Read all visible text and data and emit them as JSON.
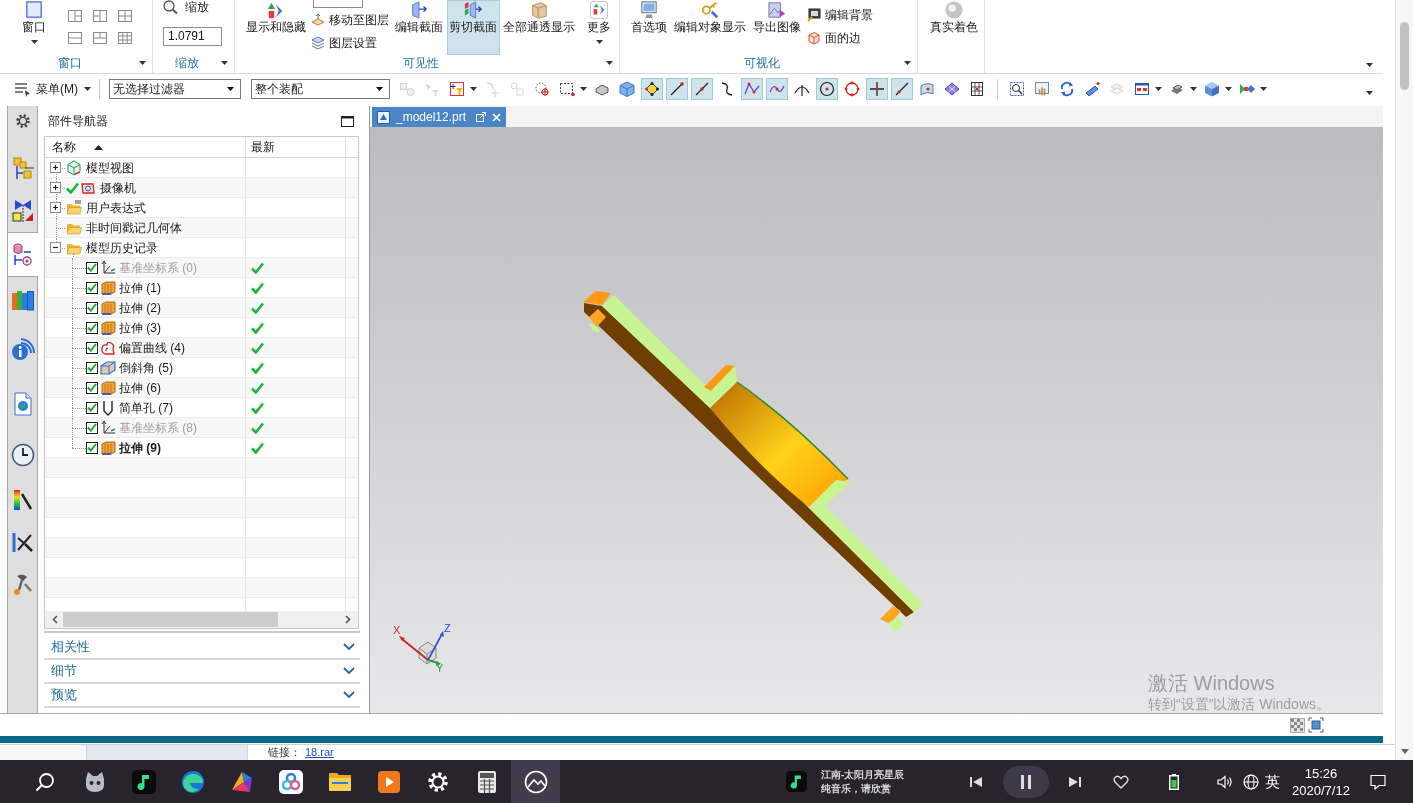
{
  "ribbon": {
    "groups": [
      {
        "label": "窗口",
        "items": [
          {
            "kind": "large",
            "label": "窗口",
            "dropdown": true,
            "selected": false
          },
          {
            "kind": "layouts"
          }
        ]
      },
      {
        "label": "缩放",
        "items": [
          {
            "kind": "zoom",
            "label": "缩放",
            "value": "1.0791"
          }
        ]
      },
      {
        "label": "可见性",
        "items": [
          {
            "kind": "large",
            "label": "显示和隐藏",
            "dropdown": false,
            "selected": false
          },
          {
            "kind": "stack",
            "entries": [
              {
                "kind": "field"
              },
              {
                "kind": "command",
                "label": "移动至图层"
              },
              {
                "kind": "command",
                "label": "图层设置"
              }
            ]
          },
          {
            "kind": "large",
            "label": "编辑截面",
            "dropdown": false,
            "selected": false
          },
          {
            "kind": "large",
            "label": "剪切截面",
            "dropdown": false,
            "selected": true
          },
          {
            "kind": "large",
            "label": "全部通透显示",
            "dropdown": false,
            "selected": false
          },
          {
            "kind": "large",
            "label": "更多",
            "dropdown": true,
            "selected": false
          }
        ]
      },
      {
        "label": "可视化",
        "items": [
          {
            "kind": "large",
            "label": "首选项",
            "dropdown": false,
            "selected": false
          },
          {
            "kind": "large",
            "label": "编辑对象显示",
            "dropdown": false,
            "selected": false
          },
          {
            "kind": "large",
            "label": "导出图像",
            "dropdown": false,
            "selected": false
          },
          {
            "kind": "stack",
            "entries": [
              {
                "kind": "command",
                "label": "编辑背景"
              },
              {
                "kind": "command",
                "label": "面的边"
              }
            ]
          }
        ]
      },
      {
        "items": [
          {
            "kind": "large",
            "label": "真实着色",
            "dropdown": false,
            "selected": false
          }
        ]
      }
    ]
  },
  "toolbar": {
    "menu": "菜单(M)",
    "filters": [
      "无选择过滤器",
      "整个装配"
    ],
    "tool_groups": [
      {
        "tools": [
          {
            "selected": false,
            "disabled": true,
            "dropdown": false
          },
          {
            "selected": false,
            "disabled": true,
            "dropdown": false
          },
          {
            "selected": false,
            "disabled": false,
            "dropdown": true
          },
          {
            "selected": false,
            "disabled": true,
            "dropdown": false
          },
          {
            "selected": false,
            "disabled": true,
            "dropdown": false
          },
          {
            "selected": false,
            "disabled": false,
            "dropdown": false
          },
          {
            "selected": false,
            "disabled": false,
            "dropdown": true
          },
          {
            "selected": false,
            "disabled": false,
            "dropdown": false
          },
          {
            "selected": false,
            "disabled": false,
            "dropdown": false
          },
          {
            "selected": true,
            "disabled": false,
            "dropdown": false
          },
          {
            "selected": true,
            "disabled": false,
            "dropdown": false
          },
          {
            "selected": true,
            "disabled": false,
            "dropdown": false
          },
          {
            "selected": false,
            "disabled": false,
            "dropdown": false
          },
          {
            "selected": true,
            "disabled": false,
            "dropdown": false
          },
          {
            "selected": true,
            "disabled": false,
            "dropdown": false
          },
          {
            "selected": false,
            "disabled": false,
            "dropdown": false
          },
          {
            "selected": true,
            "disabled": false,
            "dropdown": false
          },
          {
            "selected": false,
            "disabled": false,
            "dropdown": false
          },
          {
            "selected": true,
            "disabled": false,
            "dropdown": false
          },
          {
            "selected": true,
            "disabled": false,
            "dropdown": false
          },
          {
            "selected": false,
            "disabled": false,
            "dropdown": false
          },
          {
            "selected": false,
            "disabled": false,
            "dropdown": false
          },
          {
            "selected": false,
            "disabled": false,
            "dropdown": false
          }
        ]
      },
      {
        "tools": [
          {
            "selected": false,
            "disabled": false,
            "dropdown": false
          },
          {
            "selected": false,
            "disabled": false,
            "dropdown": false
          },
          {
            "selected": false,
            "disabled": false,
            "dropdown": false
          },
          {
            "selected": false,
            "disabled": false,
            "dropdown": false
          },
          {
            "selected": false,
            "disabled": true,
            "dropdown": false
          },
          {
            "selected": false,
            "disabled": false,
            "dropdown": true
          },
          {
            "selected": false,
            "disabled": false,
            "dropdown": true
          },
          {
            "selected": false,
            "disabled": false,
            "dropdown": true
          },
          {
            "selected": false,
            "disabled": false,
            "dropdown": true
          }
        ]
      }
    ]
  },
  "side_tabs": [
    {
      "selected": false
    },
    {
      "selected": false
    },
    {
      "selected": false
    },
    {
      "selected": true
    },
    {
      "selected": false
    },
    {
      "selected": false
    },
    {
      "selected": false
    },
    {
      "selected": false
    },
    {
      "selected": false
    },
    {
      "selected": false
    },
    {
      "selected": false
    }
  ],
  "navigator": {
    "title": "部件导航器",
    "columns": [
      {
        "label": "名称",
        "sorted": true
      },
      {
        "label": "最新",
        "sorted": false
      }
    ],
    "tree": [
      {
        "label": "模型视图",
        "kind": "views",
        "expanded": false,
        "ticked": false
      },
      {
        "label": "摄像机",
        "kind": "camera",
        "expanded": false,
        "ticked": true
      },
      {
        "label": "用户表达式",
        "kind": "expressions",
        "expanded": false,
        "ticked": false
      },
      {
        "label": "非时间戳记几何体",
        "kind": "folder",
        "ticked": false
      },
      {
        "label": "模型历史记录",
        "kind": "folder",
        "expanded": true,
        "ticked": false,
        "children": [
          {
            "label": "基准坐标系 (0)",
            "kind": "datum",
            "checked": true,
            "dimmed": true,
            "current": false,
            "latest": true
          },
          {
            "label": "拉伸 (1)",
            "kind": "extrude",
            "checked": true,
            "dimmed": false,
            "current": false,
            "latest": true
          },
          {
            "label": "拉伸 (2)",
            "kind": "extrude",
            "checked": true,
            "dimmed": false,
            "current": false,
            "latest": true
          },
          {
            "label": "拉伸 (3)",
            "kind": "extrude",
            "checked": true,
            "dimmed": false,
            "current": false,
            "latest": true
          },
          {
            "label": "偏置曲线 (4)",
            "kind": "offset_curve",
            "checked": true,
            "dimmed": false,
            "current": false,
            "latest": true
          },
          {
            "label": "倒斜角 (5)",
            "kind": "chamfer",
            "checked": true,
            "dimmed": false,
            "current": false,
            "latest": true
          },
          {
            "label": "拉伸 (6)",
            "kind": "extrude",
            "checked": true,
            "dimmed": false,
            "current": false,
            "latest": true
          },
          {
            "label": "简单孔 (7)",
            "kind": "hole",
            "checked": true,
            "dimmed": false,
            "current": false,
            "latest": true
          },
          {
            "label": "基准坐标系 (8)",
            "kind": "datum",
            "checked": true,
            "dimmed": true,
            "current": false,
            "latest": true
          },
          {
            "label": "拉伸 (9)",
            "kind": "extrude",
            "checked": true,
            "dimmed": false,
            "current": true,
            "latest": true
          }
        ]
      }
    ],
    "sections": [
      {
        "label": "相关性",
        "expanded": false
      },
      {
        "label": "细节",
        "expanded": false
      },
      {
        "label": "预览",
        "expanded": false
      }
    ]
  },
  "document_tabs": [
    {
      "label": "_model12.prt",
      "selected": true
    }
  ],
  "viewport": {
    "axes": {
      "x": "X",
      "y": "Y",
      "z": "Z"
    }
  },
  "activation_notice": {
    "title": "激活 Windows",
    "message": "转到“设置”以激活 Windows。"
  },
  "background_window": {
    "link_label": "链接：",
    "link": "18.rar"
  },
  "taskbar": {
    "apps": [
      {
        "selected": false
      },
      {
        "selected": false
      },
      {
        "selected": false
      },
      {
        "selected": false
      },
      {
        "selected": false
      },
      {
        "selected": false
      },
      {
        "selected": false
      },
      {
        "selected": false
      },
      {
        "selected": false
      },
      {
        "selected": true
      }
    ],
    "media": {
      "title": "江南-太阳月亮星辰",
      "subtitle": "纯音乐，请欣赏"
    },
    "input_method": "英",
    "time": "15:26",
    "date": "2020/7/12"
  }
}
